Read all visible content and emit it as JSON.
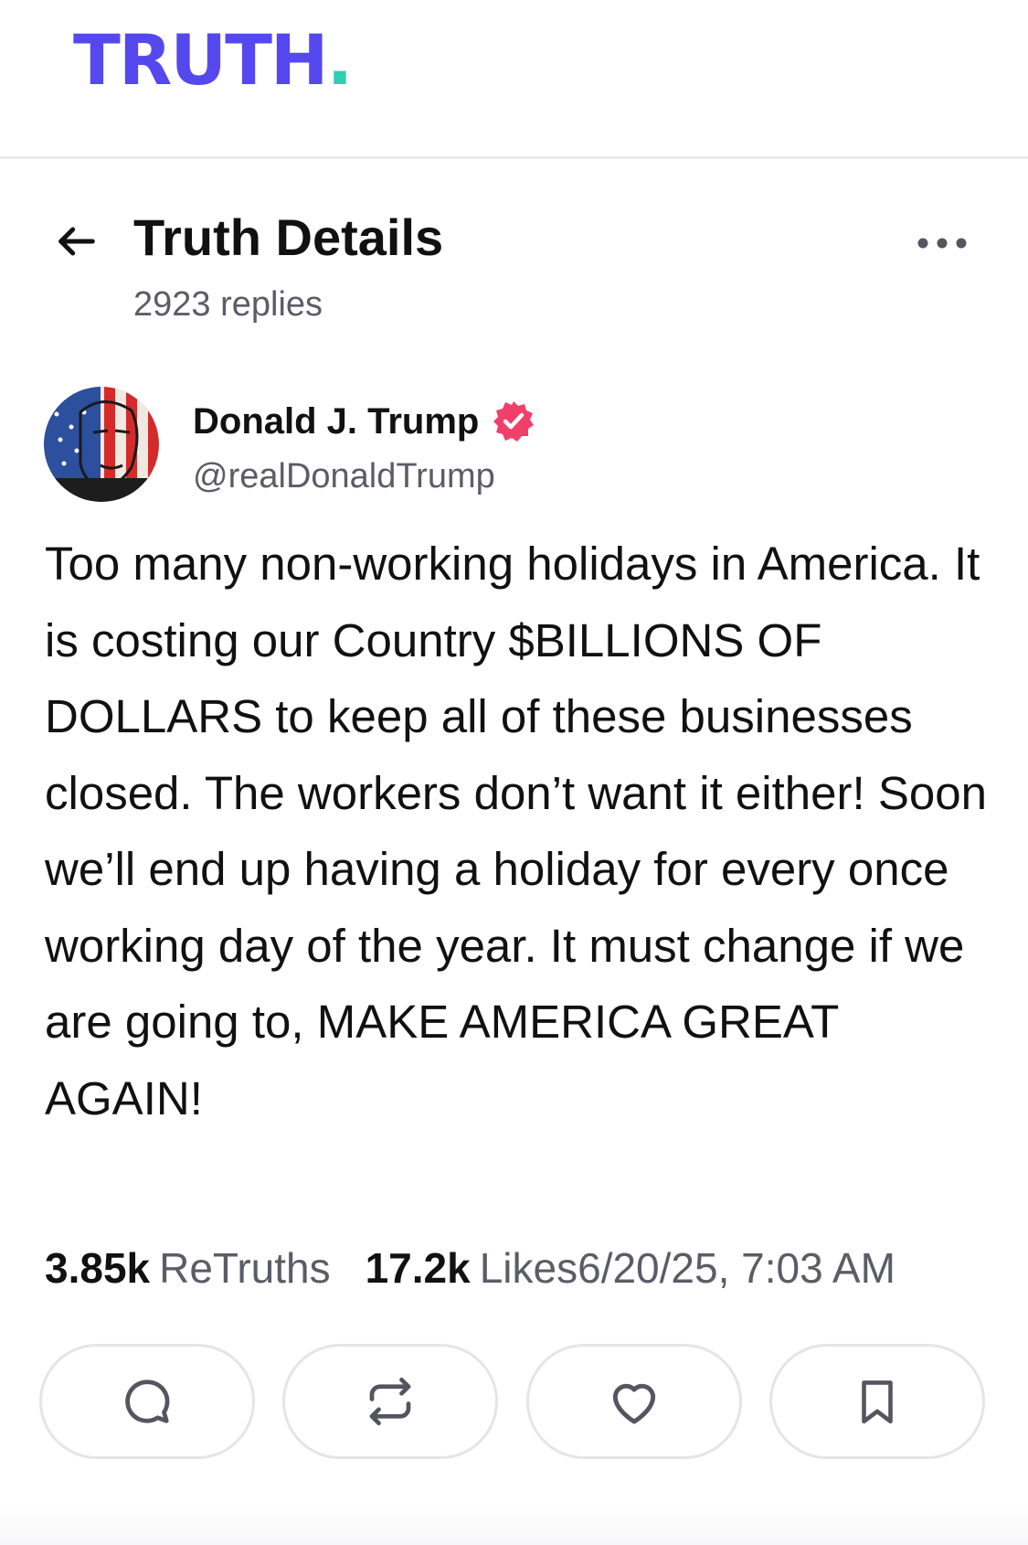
{
  "app": {
    "logo_text": "TRUTH",
    "logo_dot": ".",
    "brand_color": "#5448ee",
    "accent_color": "#2ecfb1"
  },
  "header": {
    "title": "Truth Details",
    "replies": "2923 replies",
    "back_icon": "arrow-left-icon",
    "more_icon": "more-horizontal-icon"
  },
  "post": {
    "author": {
      "display_name": "Donald J. Trump",
      "handle": "@realDonaldTrump",
      "verified": true,
      "verified_color": "#f0406a"
    },
    "text": "Too many non-working holidays in America. It is costing our Country $BILLIONS OF DOLLARS to keep all of these businesses closed. The workers don’t want it either! Soon we’ll end up having a holiday for every once working day of the year. It must change if we are going to, MAKE AMERICA GREAT AGAIN!",
    "stats": {
      "retruths_count": "3.85k",
      "retruths_label": "ReTruths",
      "likes_count": "17.2k",
      "likes_label": "Likes",
      "timestamp": "6/20/25, 7:03 AM"
    }
  },
  "actions": [
    {
      "icon": "reply-icon"
    },
    {
      "icon": "retruth-icon"
    },
    {
      "icon": "heart-icon"
    },
    {
      "icon": "bookmark-icon"
    }
  ]
}
